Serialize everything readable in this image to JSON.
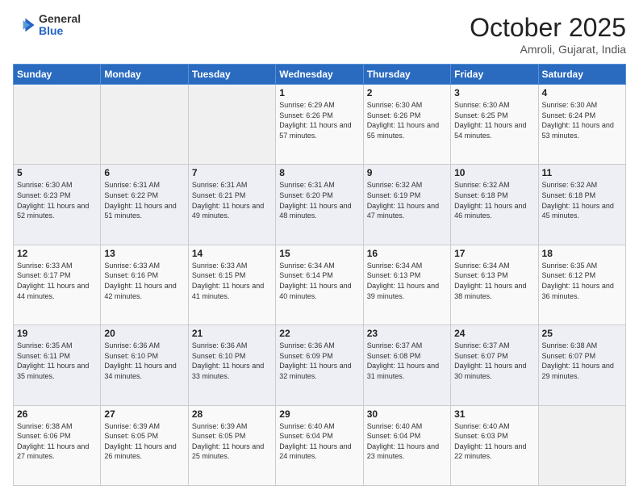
{
  "header": {
    "logo_general": "General",
    "logo_blue": "Blue",
    "month_title": "October 2025",
    "location": "Amroli, Gujarat, India"
  },
  "days_of_week": [
    "Sunday",
    "Monday",
    "Tuesday",
    "Wednesday",
    "Thursday",
    "Friday",
    "Saturday"
  ],
  "weeks": [
    [
      {
        "day": "",
        "info": ""
      },
      {
        "day": "",
        "info": ""
      },
      {
        "day": "",
        "info": ""
      },
      {
        "day": "1",
        "info": "Sunrise: 6:29 AM\nSunset: 6:26 PM\nDaylight: 11 hours and 57 minutes."
      },
      {
        "day": "2",
        "info": "Sunrise: 6:30 AM\nSunset: 6:26 PM\nDaylight: 11 hours and 55 minutes."
      },
      {
        "day": "3",
        "info": "Sunrise: 6:30 AM\nSunset: 6:25 PM\nDaylight: 11 hours and 54 minutes."
      },
      {
        "day": "4",
        "info": "Sunrise: 6:30 AM\nSunset: 6:24 PM\nDaylight: 11 hours and 53 minutes."
      }
    ],
    [
      {
        "day": "5",
        "info": "Sunrise: 6:30 AM\nSunset: 6:23 PM\nDaylight: 11 hours and 52 minutes."
      },
      {
        "day": "6",
        "info": "Sunrise: 6:31 AM\nSunset: 6:22 PM\nDaylight: 11 hours and 51 minutes."
      },
      {
        "day": "7",
        "info": "Sunrise: 6:31 AM\nSunset: 6:21 PM\nDaylight: 11 hours and 49 minutes."
      },
      {
        "day": "8",
        "info": "Sunrise: 6:31 AM\nSunset: 6:20 PM\nDaylight: 11 hours and 48 minutes."
      },
      {
        "day": "9",
        "info": "Sunrise: 6:32 AM\nSunset: 6:19 PM\nDaylight: 11 hours and 47 minutes."
      },
      {
        "day": "10",
        "info": "Sunrise: 6:32 AM\nSunset: 6:18 PM\nDaylight: 11 hours and 46 minutes."
      },
      {
        "day": "11",
        "info": "Sunrise: 6:32 AM\nSunset: 6:18 PM\nDaylight: 11 hours and 45 minutes."
      }
    ],
    [
      {
        "day": "12",
        "info": "Sunrise: 6:33 AM\nSunset: 6:17 PM\nDaylight: 11 hours and 44 minutes."
      },
      {
        "day": "13",
        "info": "Sunrise: 6:33 AM\nSunset: 6:16 PM\nDaylight: 11 hours and 42 minutes."
      },
      {
        "day": "14",
        "info": "Sunrise: 6:33 AM\nSunset: 6:15 PM\nDaylight: 11 hours and 41 minutes."
      },
      {
        "day": "15",
        "info": "Sunrise: 6:34 AM\nSunset: 6:14 PM\nDaylight: 11 hours and 40 minutes."
      },
      {
        "day": "16",
        "info": "Sunrise: 6:34 AM\nSunset: 6:13 PM\nDaylight: 11 hours and 39 minutes."
      },
      {
        "day": "17",
        "info": "Sunrise: 6:34 AM\nSunset: 6:13 PM\nDaylight: 11 hours and 38 minutes."
      },
      {
        "day": "18",
        "info": "Sunrise: 6:35 AM\nSunset: 6:12 PM\nDaylight: 11 hours and 36 minutes."
      }
    ],
    [
      {
        "day": "19",
        "info": "Sunrise: 6:35 AM\nSunset: 6:11 PM\nDaylight: 11 hours and 35 minutes."
      },
      {
        "day": "20",
        "info": "Sunrise: 6:36 AM\nSunset: 6:10 PM\nDaylight: 11 hours and 34 minutes."
      },
      {
        "day": "21",
        "info": "Sunrise: 6:36 AM\nSunset: 6:10 PM\nDaylight: 11 hours and 33 minutes."
      },
      {
        "day": "22",
        "info": "Sunrise: 6:36 AM\nSunset: 6:09 PM\nDaylight: 11 hours and 32 minutes."
      },
      {
        "day": "23",
        "info": "Sunrise: 6:37 AM\nSunset: 6:08 PM\nDaylight: 11 hours and 31 minutes."
      },
      {
        "day": "24",
        "info": "Sunrise: 6:37 AM\nSunset: 6:07 PM\nDaylight: 11 hours and 30 minutes."
      },
      {
        "day": "25",
        "info": "Sunrise: 6:38 AM\nSunset: 6:07 PM\nDaylight: 11 hours and 29 minutes."
      }
    ],
    [
      {
        "day": "26",
        "info": "Sunrise: 6:38 AM\nSunset: 6:06 PM\nDaylight: 11 hours and 27 minutes."
      },
      {
        "day": "27",
        "info": "Sunrise: 6:39 AM\nSunset: 6:05 PM\nDaylight: 11 hours and 26 minutes."
      },
      {
        "day": "28",
        "info": "Sunrise: 6:39 AM\nSunset: 6:05 PM\nDaylight: 11 hours and 25 minutes."
      },
      {
        "day": "29",
        "info": "Sunrise: 6:40 AM\nSunset: 6:04 PM\nDaylight: 11 hours and 24 minutes."
      },
      {
        "day": "30",
        "info": "Sunrise: 6:40 AM\nSunset: 6:04 PM\nDaylight: 11 hours and 23 minutes."
      },
      {
        "day": "31",
        "info": "Sunrise: 6:40 AM\nSunset: 6:03 PM\nDaylight: 11 hours and 22 minutes."
      },
      {
        "day": "",
        "info": ""
      }
    ]
  ]
}
